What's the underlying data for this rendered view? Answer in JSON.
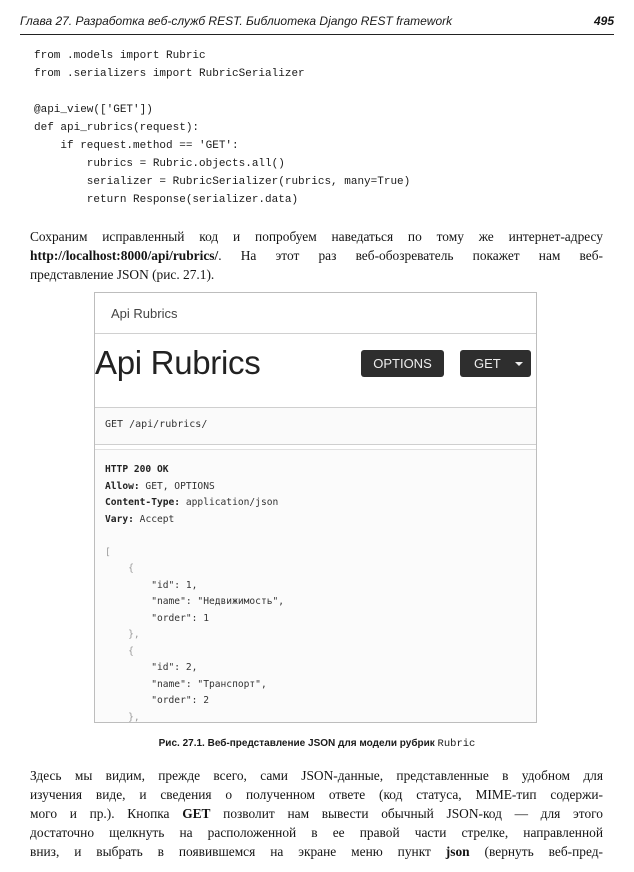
{
  "header": {
    "title": "Глава 27. Разработка веб-служб REST. Библиотека Django REST framework",
    "page_number": "495"
  },
  "code_lines": [
    "from .models import Rubric",
    "from .serializers import RubricSerializer",
    "",
    "@api_view(['GET'])",
    "def api_rubrics(request):",
    "    if request.method == 'GET':",
    "        rubrics = Rubric.objects.all()",
    "        serializer = RubricSerializer(rubrics, many=True)",
    "        return Response(serializer.data)"
  ],
  "paragraph1": {
    "line1": "Сохраним исправленный код и попробуем наведаться по тому же интернет-адресу",
    "url": "http://localhost:8000/api/rubrics/",
    "line2_rest": ". На этот раз веб-обозреватель покажет нам веб-",
    "line3": "представление JSON (рис. 27.1)."
  },
  "figure": {
    "brand": "Api Rubrics",
    "title": "Api Rubrics",
    "options_button": "OPTIONS",
    "get_button": "GET",
    "request_line": "GET /api/rubrics/",
    "status_line": "HTTP 200 OK",
    "headers": [
      {
        "name": "Allow:",
        "value": " GET, OPTIONS"
      },
      {
        "name": "Content-Type:",
        "value": " application/json"
      },
      {
        "name": "Vary:",
        "value": " Accept"
      }
    ],
    "json_lines": [
      "[",
      "    {",
      "        \"id\": 1,",
      "        \"name\": \"Недвижимость\",",
      "        \"order\": 1",
      "    },",
      "    {",
      "        \"id\": 2,",
      "        \"name\": \"Транспорт\",",
      "        \"order\": 2",
      "    },"
    ]
  },
  "caption": {
    "label": "Рис. 27.1. Веб-представление JSON для модели рубрик ",
    "code": "Rubric"
  },
  "paragraph2": {
    "line1": "Здесь мы видим, прежде всего, сами JSON-данные, представленные в удобном для",
    "line2": "изучения виде, и сведения о полученном ответе (код статуса, MIME-тип содержи-",
    "line3_start": "мого и пр.). Кнопка ",
    "line3_bold": "GET",
    "line3_end": " позволит нам вывести обычный JSON-код — для этого",
    "line4": "достаточно щелкнуть на расположенной в ее правой части стрелке, направленной",
    "line5_start": "вниз, и выбрать в появившемся на экране меню пункт ",
    "line5_bold": "json",
    "line5_end": " (вернуть веб-пред-"
  }
}
